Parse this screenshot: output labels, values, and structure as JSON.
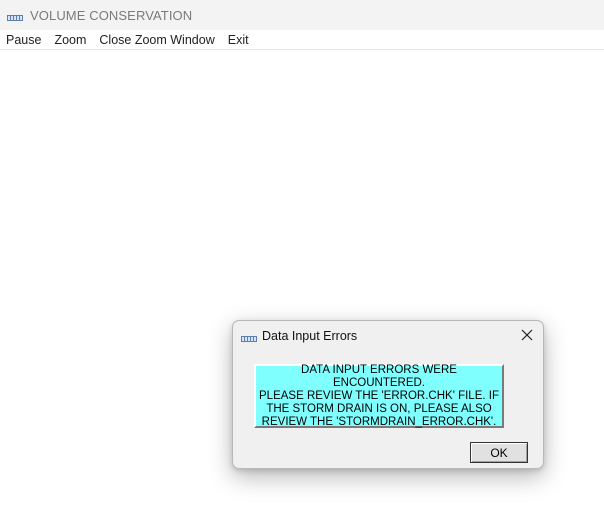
{
  "window": {
    "title": "VOLUME CONSERVATION",
    "icon": "app-logo-icon"
  },
  "menu": {
    "items": [
      {
        "label": "Pause"
      },
      {
        "label": "Zoom"
      },
      {
        "label": "Close Zoom Window"
      },
      {
        "label": "Exit"
      }
    ]
  },
  "dialog": {
    "title": "Data Input Errors",
    "icon": "app-logo-icon",
    "close_icon": "close-icon",
    "message": "DATA INPUT ERRORS WERE ENCOUNTERED.\nPLEASE REVIEW THE 'ERROR.CHK' FILE. IF\nTHE STORM DRAIN IS ON, PLEASE ALSO\nREVIEW THE 'STORMDRAIN_ERROR.CHK'.",
    "message_bg_color": "#80ffff",
    "ok_label": "OK"
  }
}
